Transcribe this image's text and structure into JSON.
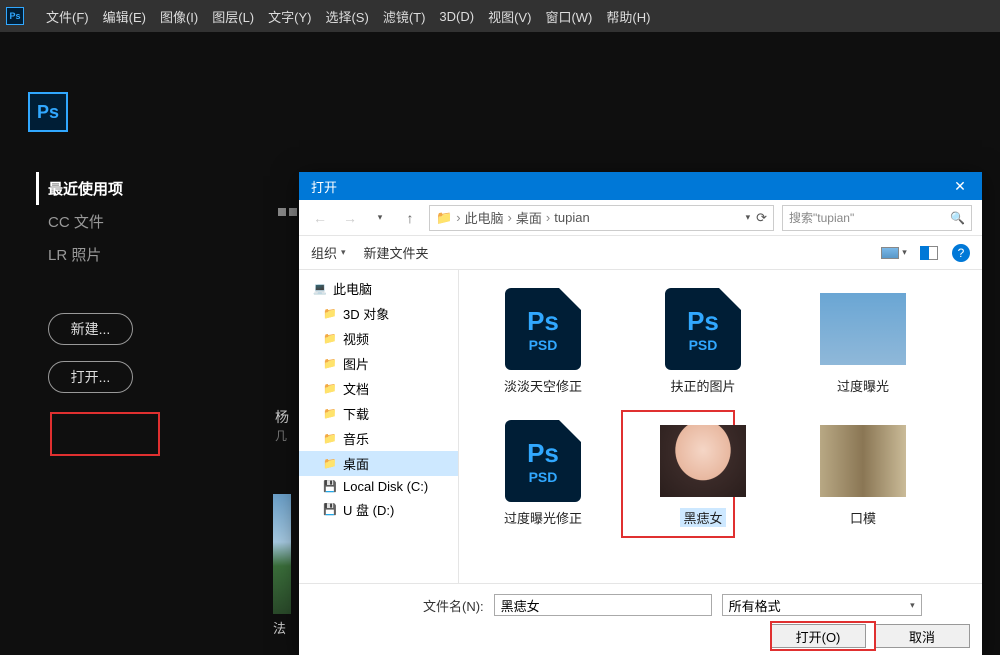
{
  "menubar": {
    "items": [
      "文件(F)",
      "编辑(E)",
      "图像(I)",
      "图层(L)",
      "文字(Y)",
      "选择(S)",
      "滤镜(T)",
      "3D(D)",
      "视图(V)",
      "窗口(W)",
      "帮助(H)"
    ]
  },
  "home": {
    "tabs": [
      "最近使用项",
      "CC 文件",
      "LR 照片"
    ],
    "buttons": {
      "new": "新建...",
      "open": "打开..."
    },
    "recent_top": {
      "label": "杨",
      "meta": "几"
    },
    "recent_bottom": {
      "label": "法"
    }
  },
  "dialog": {
    "title": "打开",
    "breadcrumb": [
      "此电脑",
      "桌面",
      "tupian"
    ],
    "search_placeholder": "搜索\"tupian\"",
    "toolbar": {
      "organize": "组织",
      "newfolder": "新建文件夹"
    },
    "tree": [
      {
        "label": "此电脑",
        "icon": "pc",
        "root": true
      },
      {
        "label": "3D 对象",
        "icon": "folder"
      },
      {
        "label": "视频",
        "icon": "folder"
      },
      {
        "label": "图片",
        "icon": "folder"
      },
      {
        "label": "文档",
        "icon": "folder"
      },
      {
        "label": "下载",
        "icon": "folder"
      },
      {
        "label": "音乐",
        "icon": "folder"
      },
      {
        "label": "桌面",
        "icon": "folder",
        "selected": true
      },
      {
        "label": "Local Disk (C:)",
        "icon": "disk"
      },
      {
        "label": "U 盘 (D:)",
        "icon": "disk"
      }
    ],
    "files": [
      {
        "label": "淡淡天空修正",
        "type": "psd"
      },
      {
        "label": "扶正的图片",
        "type": "psd"
      },
      {
        "label": "过度曝光",
        "type": "img-portrait"
      },
      {
        "label": "过度曝光修正",
        "type": "psd"
      },
      {
        "label": "黑痣女",
        "type": "img-face",
        "selected": true
      },
      {
        "label": "口模",
        "type": "img-factory"
      }
    ],
    "footer": {
      "filename_label": "文件名(N):",
      "filename_value": "黑痣女",
      "filter": "所有格式",
      "open_btn": "打开(O)",
      "cancel_btn": "取消"
    }
  }
}
